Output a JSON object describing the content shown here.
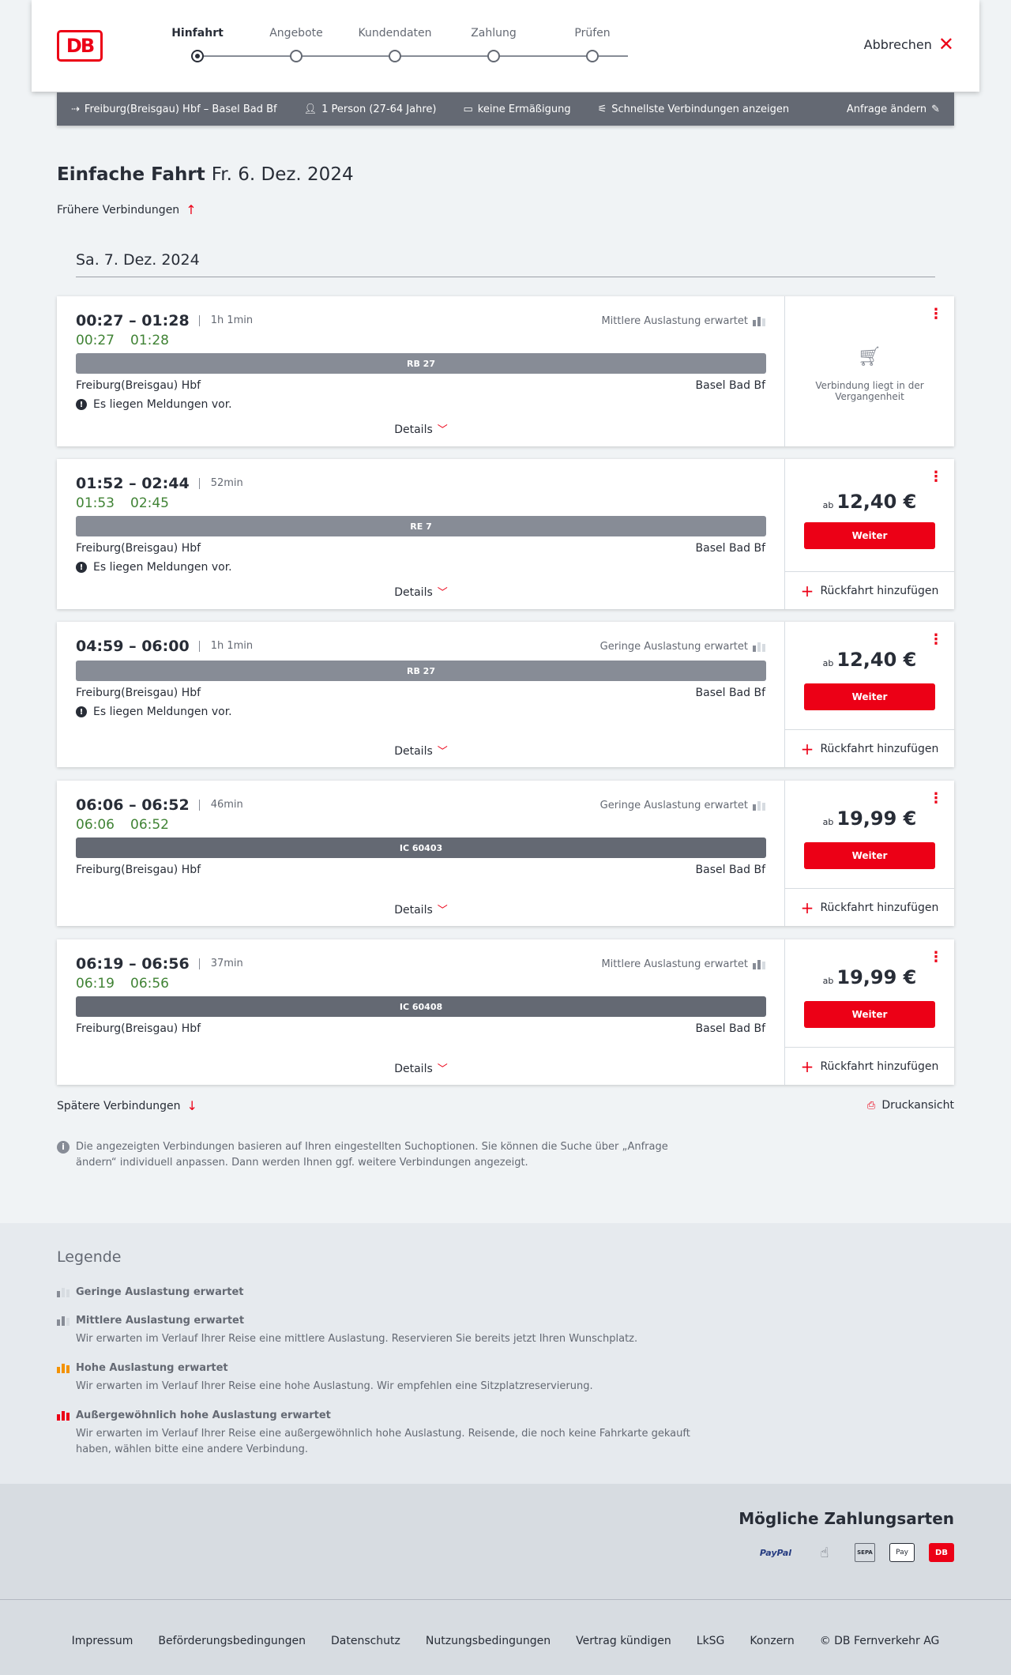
{
  "header": {
    "logo": "DB",
    "steps": [
      "Hinfahrt",
      "Angebote",
      "Kundendaten",
      "Zahlung",
      "Prüfen"
    ],
    "active_step": 0,
    "abort": "Abbrechen"
  },
  "search": {
    "route": "Freiburg(Breisgau) Hbf – Basel Bad Bf",
    "persons": "1 Person (27-64 Jahre)",
    "discount": "keine Ermäßigung",
    "options": "Schnellste Verbindungen anzeigen",
    "edit": "Anfrage ändern"
  },
  "title": {
    "type": "Einfache Fahrt",
    "date": "Fr. 6. Dez. 2024"
  },
  "earlier": "Frühere Verbindungen",
  "day_header": "Sa. 7. Dez. 2024",
  "connections": [
    {
      "times": "00:27 – 01:28",
      "duration": "1h 1min",
      "rt_dep": "00:27",
      "rt_arr": "01:28",
      "train": "RB 27",
      "from": "Freiburg(Breisgau) Hbf",
      "to": "Basel Bad Bf",
      "message": "Es liegen Meldungen vor.",
      "load": "Mittlere Auslastung erwartet",
      "details": "Details",
      "past_text": "Verbindung liegt in der Vergangenheit"
    },
    {
      "times": "01:52 – 02:44",
      "duration": "52min",
      "rt_dep": "01:53",
      "rt_arr": "02:45",
      "train": "RE 7",
      "from": "Freiburg(Breisgau) Hbf",
      "to": "Basel Bad Bf",
      "message": "Es liegen Meldungen vor.",
      "details": "Details",
      "price_prefix": "ab",
      "price": "12,40 €",
      "cta": "Weiter",
      "return": "Rückfahrt hinzufügen"
    },
    {
      "times": "04:59 – 06:00",
      "duration": "1h 1min",
      "train": "RB 27",
      "from": "Freiburg(Breisgau) Hbf",
      "to": "Basel Bad Bf",
      "message": "Es liegen Meldungen vor.",
      "load": "Geringe Auslastung erwartet",
      "details": "Details",
      "price_prefix": "ab",
      "price": "12,40 €",
      "cta": "Weiter",
      "return": "Rückfahrt hinzufügen"
    },
    {
      "times": "06:06 – 06:52",
      "duration": "46min",
      "rt_dep": "06:06",
      "rt_arr": "06:52",
      "train": "IC 60403",
      "from": "Freiburg(Breisgau) Hbf",
      "to": "Basel Bad Bf",
      "load": "Geringe Auslastung erwartet",
      "details": "Details",
      "price_prefix": "ab",
      "price": "19,99 €",
      "cta": "Weiter",
      "return": "Rückfahrt hinzufügen"
    },
    {
      "times": "06:19 – 06:56",
      "duration": "37min",
      "rt_dep": "06:19",
      "rt_arr": "06:56",
      "train": "IC 60408",
      "from": "Freiburg(Breisgau) Hbf",
      "to": "Basel Bad Bf",
      "load": "Mittlere Auslastung erwartet",
      "details": "Details",
      "price_prefix": "ab",
      "price": "19,99 €",
      "cta": "Weiter",
      "return": "Rückfahrt hinzufügen"
    }
  ],
  "later": "Spätere Verbindungen",
  "print": "Druckansicht",
  "note": "Die angezeigten Verbindungen basieren auf Ihren eingestellten Suchoptionen. Sie können die Suche über „Anfrage ändern“ individuell anpassen. Dann werden Ihnen ggf. weitere Verbindungen angezeigt.",
  "legend": {
    "title": "Legende",
    "items": [
      {
        "title": "Geringe Auslastung erwartet",
        "desc": ""
      },
      {
        "title": "Mittlere Auslastung erwartet",
        "desc": "Wir erwarten im Verlauf Ihrer Reise eine mittlere Auslastung. Reservieren Sie bereits jetzt Ihren Wunschplatz."
      },
      {
        "title": "Hohe Auslastung erwartet",
        "desc": "Wir erwarten im Verlauf Ihrer Reise eine hohe Auslastung. Wir empfehlen eine Sitzplatzreservierung."
      },
      {
        "title": "Außergewöhnlich hohe Auslastung erwartet",
        "desc": "Wir erwarten im Verlauf Ihrer Reise eine außergewöhnlich hohe Auslastung. Reisende, die noch keine Fahrkarte gekauft haben, wählen bitte eine andere Verbindung."
      }
    ]
  },
  "payment": {
    "title": "Mögliche Zahlungsarten",
    "methods": [
      "PayPal",
      "Kreditkarte",
      "SEPA",
      "Pay",
      "DB"
    ]
  },
  "footer": [
    "Impressum",
    "Beförderungsbedingungen",
    "Datenschutz",
    "Nutzungsbedingungen",
    "Vertrag kündigen",
    "LkSG",
    "Konzern",
    "© DB Fernverkehr AG"
  ]
}
